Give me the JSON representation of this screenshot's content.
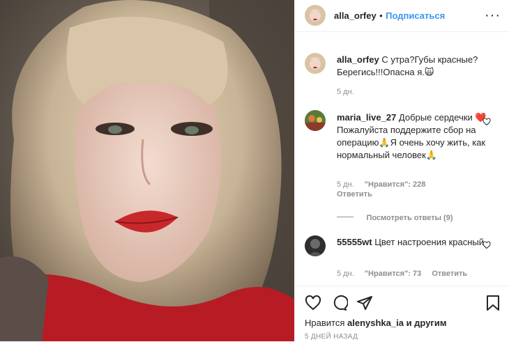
{
  "header": {
    "username": "alla_orfey",
    "separator": "•",
    "follow_label": "Подписаться",
    "more_label": "···"
  },
  "caption": {
    "username": "alla_orfey",
    "text": "С утра?Губы красные? Берегись!!!Опасна я.🙀",
    "time": "5 дн."
  },
  "comments": [
    {
      "username": "maria_live_27",
      "text": "Добрые сердечки ❤️ Пожалуйста поддержите сбор на операцию🙏Я очень хочу жить, как нормальный человек🙏",
      "time": "5 дн.",
      "likes": "\"Нравится\": 228",
      "reply_label": "Ответить",
      "view_replies": "Посмотреть ответы (9)"
    },
    {
      "username": "55555wt",
      "text": "Цвет настроения красный",
      "time": "5 дн.",
      "likes": "\"Нравится\": 73",
      "reply_label": "Ответить"
    }
  ],
  "footer": {
    "liked_by_prefix": "Нравится",
    "liked_by_user": "alenyshka_ia",
    "liked_by_suffix": "и другим",
    "timestamp": "5 ДНЕЙ НАЗАД"
  },
  "icons": [
    "heart-icon",
    "comment-icon",
    "share-icon",
    "bookmark-icon",
    "more-icon"
  ],
  "colors": {
    "link": "#3897f0",
    "text": "#262626",
    "muted": "#8e8e8e",
    "heart_red": "#ed4956"
  }
}
